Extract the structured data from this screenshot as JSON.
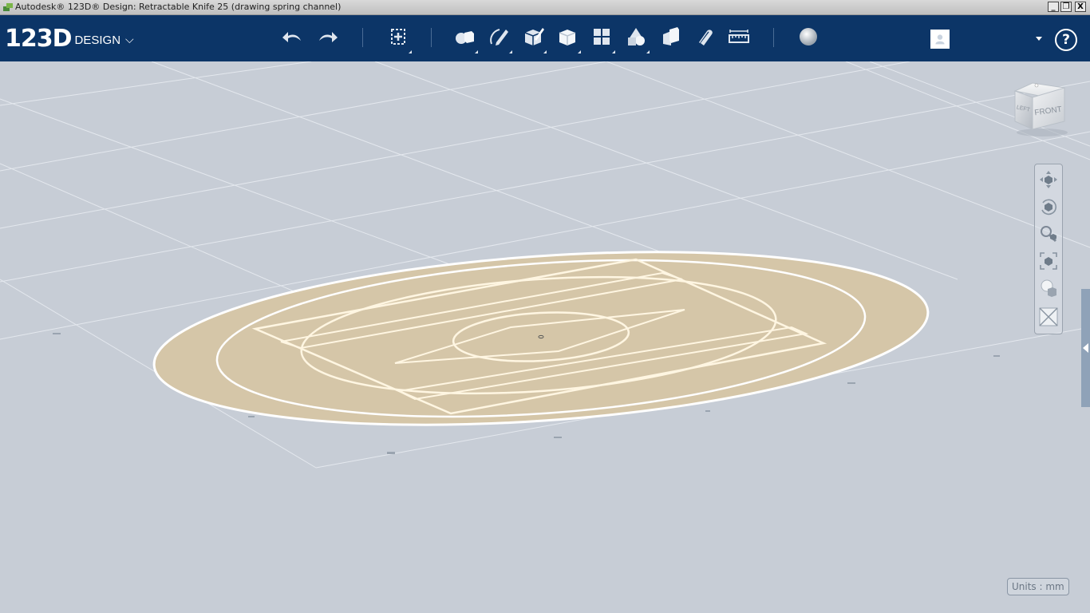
{
  "window": {
    "title": "Autodesk® 123D® Design: Retractable Knife 25 (drawing spring channel)",
    "minimize_label": "_",
    "restore_label": "❐",
    "close_label": "X"
  },
  "app": {
    "logo_big": "123D",
    "logo_small": "DESIGN",
    "logo_chevron": "⌵"
  },
  "toolbar": {
    "tools": [
      {
        "name": "undo",
        "icon": "undo-icon"
      },
      {
        "name": "redo",
        "icon": "redo-icon"
      },
      {
        "name": "transform",
        "icon": "transform-icon"
      },
      {
        "name": "primitives",
        "icon": "primitives-icon"
      },
      {
        "name": "sketch",
        "icon": "sketch-icon"
      },
      {
        "name": "construct",
        "icon": "construct-icon"
      },
      {
        "name": "modify",
        "icon": "modify-icon"
      },
      {
        "name": "pattern",
        "icon": "pattern-icon"
      },
      {
        "name": "grouping",
        "icon": "grouping-icon"
      },
      {
        "name": "combine",
        "icon": "combine-icon"
      },
      {
        "name": "snap",
        "icon": "snap-icon"
      },
      {
        "name": "measure",
        "icon": "measure-icon"
      },
      {
        "name": "material",
        "icon": "material-icon"
      }
    ],
    "help_label": "?"
  },
  "viewcube": {
    "front_label": "FRONT",
    "left_label": "LEFT"
  },
  "navbar": {
    "items": [
      "pan-icon",
      "orbit-icon",
      "zoom-icon",
      "fit-icon",
      "visual-style-icon",
      "material-toggle-icon"
    ]
  },
  "status": {
    "units_label": "Units : mm"
  },
  "colors": {
    "toolbar_bg": "#0c3567",
    "viewport_bg": "#c7cdd6",
    "sketch_fill": "#d5c6a8",
    "sketch_line": "#fff6e2"
  }
}
